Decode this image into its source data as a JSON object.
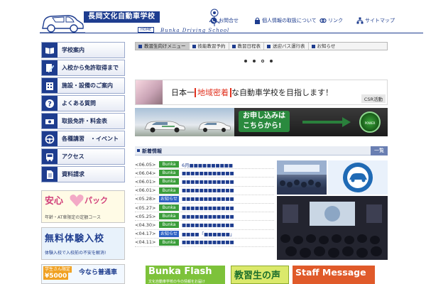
{
  "header": {
    "school_name": "長岡文化自動車学校",
    "home_label": "HOME",
    "subtitle": "Bunka Driving School",
    "links": [
      {
        "label": "お問合せ",
        "icon": "phone-icon"
      },
      {
        "label": "個人情報の取扱について",
        "icon": "lock-icon"
      },
      {
        "label": "リンク",
        "icon": "link-icon"
      },
      {
        "label": "サイトマップ",
        "icon": "sitemap-icon"
      }
    ]
  },
  "sidebar": {
    "items": [
      {
        "label": "学校案内",
        "icon": "book-icon"
      },
      {
        "label": "入校から免許取得まで",
        "icon": "pen-icon"
      },
      {
        "label": "施設・設備のご案内",
        "icon": "building-icon"
      },
      {
        "label": "よくある質問",
        "icon": "question-icon"
      },
      {
        "label": "取扱免許・料金表",
        "icon": "money-icon"
      },
      {
        "label": "各種講習　・イベント",
        "icon": "steering-wheel-icon"
      },
      {
        "label": "アクセス",
        "icon": "bus-icon"
      },
      {
        "label": "資料請求",
        "icon": "document-icon"
      }
    ]
  },
  "side_banners": {
    "anshin": {
      "title_left": "安心",
      "title_right": "パック",
      "caption": "年齢・AT車限定の定額コース"
    },
    "muryo": {
      "title": "無料体験入校",
      "caption": "体験入校で入校前の不安を解消!"
    },
    "futsu": {
      "badge_top": "学生さん限定",
      "badge_amount": "¥5000",
      "title": "今なら普通車"
    }
  },
  "tabs": [
    {
      "label": "教習生向けメニュー"
    },
    {
      "label": "技能教習予約"
    },
    {
      "label": "教習日程表"
    },
    {
      "label": "送迎バス運行表"
    },
    {
      "label": "お知らせ"
    }
  ],
  "banners": {
    "chiiki": {
      "prefix": "日本一",
      "highlight": "地域密着",
      "suffix": "な自動車学校を目指します！",
      "csr": "CSR活動"
    },
    "apply": {
      "line1": "お申し込みは",
      "line2": "こちらから!",
      "power": "POWER"
    }
  },
  "news": {
    "heading": "新着情報",
    "more_label": "一覧",
    "items": [
      {
        "date": "<06.05>",
        "tag": "Bunka",
        "title": "6月■■■■■■■■■■"
      },
      {
        "date": "<06.04>",
        "tag": "Bunka",
        "title": "■■■■■■■■■■■■"
      },
      {
        "date": "<06.01>",
        "tag": "Bunka",
        "title": "■■■■■■■■■■■■"
      },
      {
        "date": "<06.01>",
        "tag": "Bunka",
        "title": "■■■■■■■■■■■■"
      },
      {
        "date": "<05.28>",
        "tag": "お知らせ",
        "title": "■■■■■■■■■■■■"
      },
      {
        "date": "<05.27>",
        "tag": "Bunka",
        "title": "■■■■■■■■■■■■"
      },
      {
        "date": "<05.25>",
        "tag": "Bunka",
        "title": "■■■■■■■■■■■■"
      },
      {
        "date": "<04.30>",
        "tag": "Bunka",
        "title": "■■■■■■■■■■■■"
      },
      {
        "date": "<04.17>",
        "tag": "お知らせ",
        "title": "■■■■「■■■■■■」"
      },
      {
        "date": "<04.11>",
        "tag": "Bunka",
        "title": "■■■■■■■■■■■■"
      }
    ]
  },
  "bottom_banners": {
    "flash": {
      "title": "Bunka Flash",
      "caption": "文化自動車学校の今の情報をお届け"
    },
    "voice": {
      "title": "教習生の声"
    },
    "staff": {
      "title": "Staff Message"
    }
  },
  "colors": {
    "brand": "#1e3d8f",
    "green": "#3b9d3b",
    "blue_tag": "#2e62c4",
    "pink": "#d1407a"
  }
}
